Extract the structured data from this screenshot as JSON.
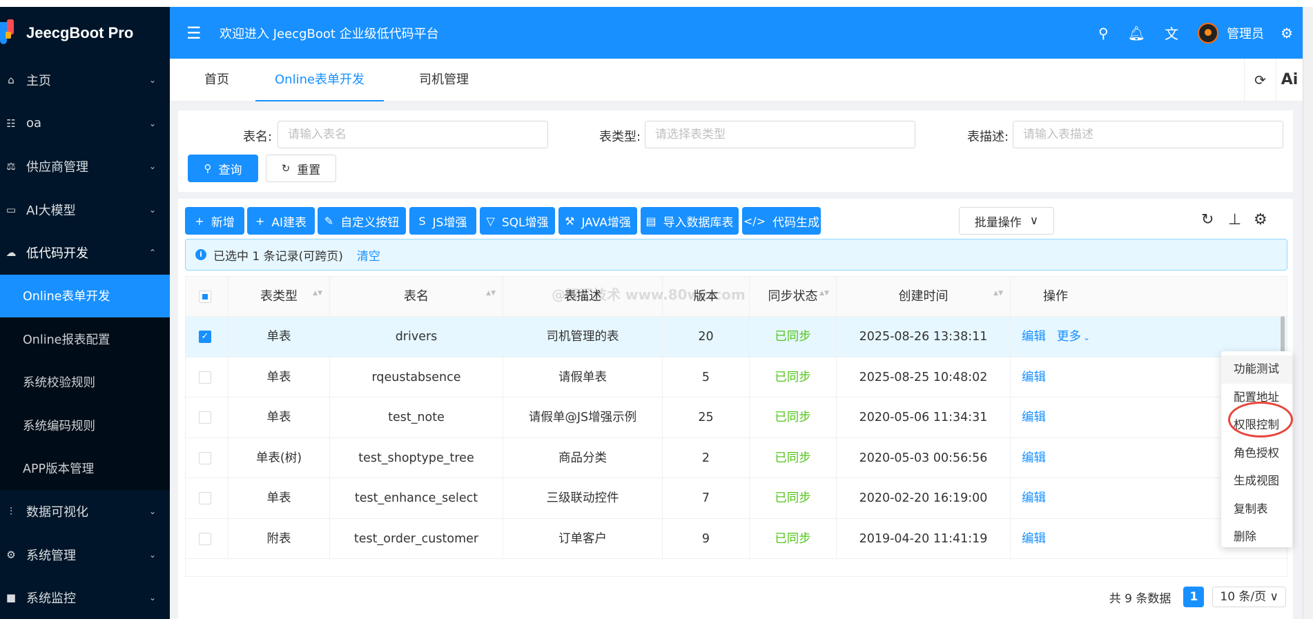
{
  "app": {
    "logo_text": "JeecgBoot Pro"
  },
  "sidebar": {
    "items": [
      {
        "label": "主页",
        "icon": "home-icon",
        "glyph": "⌂",
        "arrow": "⌄"
      },
      {
        "label": "oa",
        "icon": "grid-icon",
        "glyph": "☷",
        "arrow": "⌄"
      },
      {
        "label": "供应商管理",
        "icon": "supplier-icon",
        "glyph": "⚖",
        "arrow": "⌄"
      },
      {
        "label": "AI大模型",
        "icon": "model-icon",
        "glyph": "▭",
        "arrow": "⌄"
      },
      {
        "label": "低代码开发",
        "icon": "cloud-icon",
        "glyph": "☁",
        "arrow": "⌃"
      }
    ],
    "sub_items": [
      {
        "label": "Online表单开发",
        "active": true
      },
      {
        "label": "Online报表配置"
      },
      {
        "label": "系统校验规则"
      },
      {
        "label": "系统编码规则"
      },
      {
        "label": "APP版本管理"
      }
    ],
    "bottom_items": [
      {
        "label": "数据可视化",
        "icon": "chart-icon",
        "glyph": "⫶",
        "arrow": "⌄"
      },
      {
        "label": "系统管理",
        "icon": "settings-icon",
        "glyph": "⚙",
        "arrow": "⌄"
      },
      {
        "label": "系统监控",
        "icon": "monitor-icon",
        "glyph": "■",
        "arrow": "⌄"
      }
    ]
  },
  "header": {
    "menu_glyph": "☰",
    "welcome": "欢迎进入 JeecgBoot 企业级低代码平台",
    "search_glyph": "⚲",
    "bell_glyph": "🔔︎",
    "translate_glyph": "文",
    "username": "管理员",
    "gear_glyph": "⚙"
  },
  "tabs": [
    {
      "label": "首页"
    },
    {
      "label": "Online表单开发",
      "active": true
    },
    {
      "label": "司机管理"
    }
  ],
  "tab_tools": {
    "refresh_glyph": "⟳",
    "ai_label": "Ai"
  },
  "search": {
    "fields": [
      {
        "label": "表名:",
        "placeholder": "请输入表名"
      },
      {
        "label": "表类型:",
        "placeholder": "请选择表类型"
      },
      {
        "label": "表描述:",
        "placeholder": "请输入表描述"
      }
    ],
    "query_label": "查询",
    "query_glyph": "⚲",
    "reset_label": "重置",
    "reset_glyph": "↻"
  },
  "toolbar": {
    "buttons": [
      {
        "label": "新增",
        "glyph": "+"
      },
      {
        "label": "AI建表",
        "glyph": "+"
      },
      {
        "label": "自定义按钮",
        "glyph": "✎"
      },
      {
        "label": "JS增强",
        "glyph": "S"
      },
      {
        "label": "SQL增强",
        "glyph": "▽"
      },
      {
        "label": "JAVA增强",
        "glyph": "⚒"
      },
      {
        "label": "导入数据库表",
        "glyph": "▤"
      },
      {
        "label": "代码生成",
        "glyph": "</>"
      }
    ],
    "batch_label": "批量操作",
    "batch_glyph": "∨",
    "right_icons": {
      "reload": "↻",
      "height": "⊥",
      "settings": "⚙"
    }
  },
  "alert": {
    "info_glyph": "i",
    "text": "已选中 1 条记录(可跨页)",
    "clear": "清空"
  },
  "table": {
    "columns": [
      "表类型",
      "表名",
      "表描述",
      "版本",
      "同步状态",
      "创建时间",
      "操作"
    ],
    "watermark": "@智汇技术  www.80wz.com",
    "check_glyph": "✓",
    "sort_glyph": "▲▼",
    "edit_label": "编辑",
    "more_label": "更多",
    "more_glyph": "⌄",
    "rows": [
      {
        "type": "单表",
        "name": "drivers",
        "desc": "司机管理的表",
        "version": "20",
        "sync": "已同步",
        "created": "2025-08-26 13:38:11",
        "checked": true
      },
      {
        "type": "单表",
        "name": "rqeustabsence",
        "desc": "请假单表",
        "version": "5",
        "sync": "已同步",
        "created": "2025-08-25 10:48:02"
      },
      {
        "type": "单表",
        "name": "test_note",
        "desc": "请假单@JS增强示例",
        "version": "25",
        "sync": "已同步",
        "created": "2020-05-06 11:34:31"
      },
      {
        "type": "单表(树)",
        "name": "test_shoptype_tree",
        "desc": "商品分类",
        "version": "2",
        "sync": "已同步",
        "created": "2020-05-03 00:56:56"
      },
      {
        "type": "单表",
        "name": "test_enhance_select",
        "desc": "三级联动控件",
        "version": "7",
        "sync": "已同步",
        "created": "2020-02-20 16:19:00"
      },
      {
        "type": "附表",
        "name": "test_order_customer",
        "desc": "订单客户",
        "version": "9",
        "sync": "已同步",
        "created": "2019-04-20 11:41:19"
      }
    ]
  },
  "pagination": {
    "total": "共 9 条数据",
    "page": "1",
    "page_size": "10 条/页 ∨"
  },
  "dropdown": {
    "items": [
      "功能测试",
      "配置地址",
      "权限控制",
      "角色授权",
      "生成视图",
      "复制表",
      "删除"
    ]
  }
}
